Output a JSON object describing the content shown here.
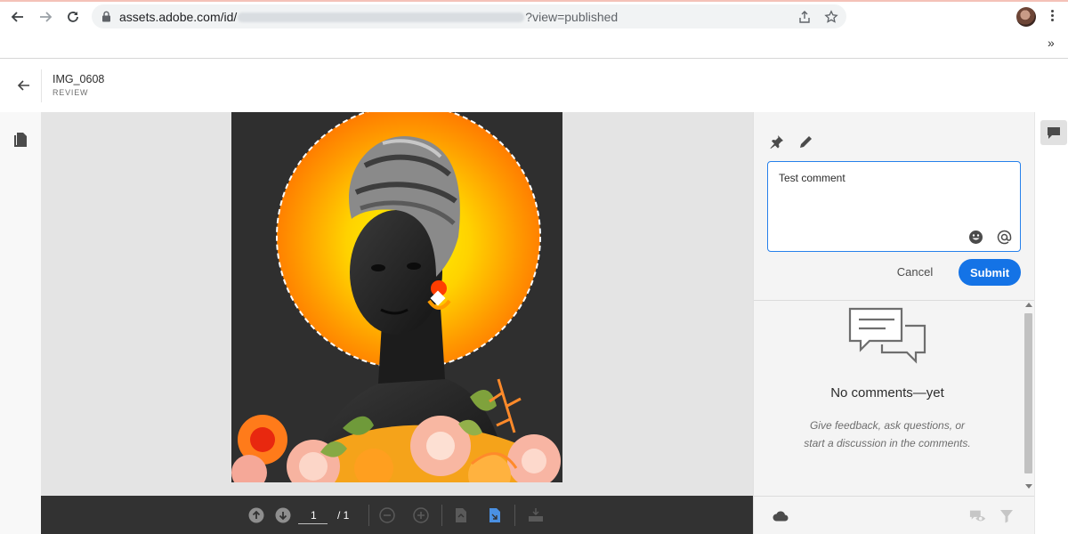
{
  "browser": {
    "url_prefix": "assets.adobe.com/id/",
    "url_suffix": "?view=published",
    "colors": {
      "chrome_bg": "#ffffff",
      "omnibox_bg": "#f1f3f4"
    }
  },
  "header": {
    "asset_name": "IMG_0608",
    "asset_subtitle": "REVIEW"
  },
  "viewer": {
    "current_page": "1",
    "total_pages": "/ 1",
    "toolbar_icons": [
      "arrow-up-circle-icon",
      "arrow-down-circle-icon",
      "zoom-out-icon",
      "zoom-in-icon",
      "fit-page-icon",
      "fit-width-icon",
      "annotation-toolbar-icon"
    ]
  },
  "comment_panel": {
    "draft_text": "Test comment",
    "cancel_label": "Cancel",
    "submit_label": "Submit",
    "empty_title": "No comments—yet",
    "empty_description": "Give feedback, ask questions, or start a discussion in the comments.",
    "tool_icons": [
      "pin-icon",
      "pencil-icon"
    ],
    "colors": {
      "accent": "#1473e6",
      "input_border": "#2680eb"
    }
  },
  "artwork": {
    "colors": {
      "halo_outer": "#ff8c00",
      "halo_inner": "#ffe600",
      "background": "#2f2f2f"
    }
  }
}
